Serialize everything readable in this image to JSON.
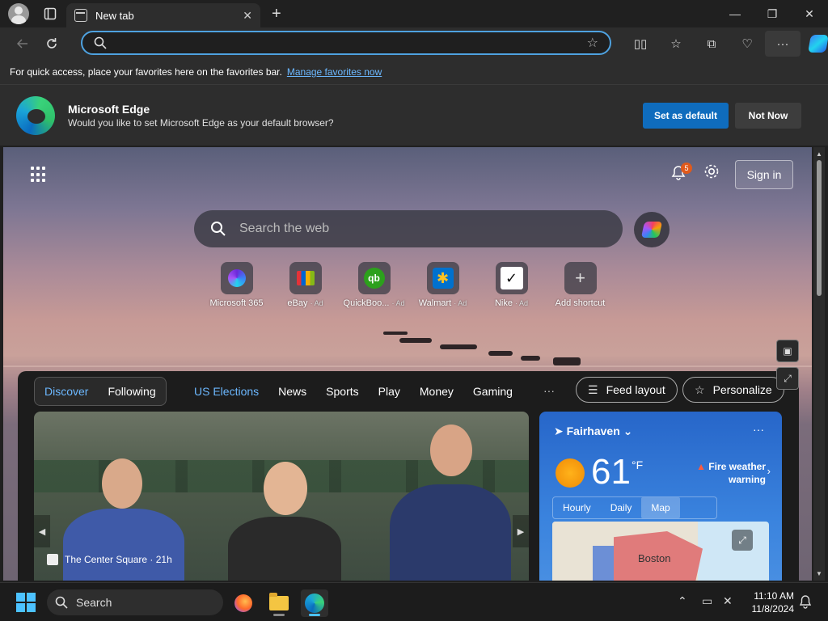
{
  "browser": {
    "tab_title": "New tab",
    "close_tab": "✕",
    "new_tab": "+",
    "minimize": "—",
    "restore": "❐",
    "close": "✕",
    "address_value": "",
    "address_placeholder": ""
  },
  "favorites_bar": {
    "message": "For quick access, place your favorites here on the favorites bar.",
    "link": "Manage favorites now"
  },
  "default_banner": {
    "title": "Microsoft Edge",
    "subtitle": "Would you like to set Microsoft Edge as your default browser?",
    "set_default": "Set as default",
    "not_now": "Not Now"
  },
  "page": {
    "notification_count": "5",
    "sign_in": "Sign in",
    "search_placeholder": "Search the web",
    "quick_links": [
      {
        "label": "Microsoft 365",
        "ad": ""
      },
      {
        "label": "eBay",
        "ad": "· Ad"
      },
      {
        "label": "QuickBoo...",
        "ad": "· Ad"
      },
      {
        "label": "Walmart",
        "ad": "· Ad"
      },
      {
        "label": "Nike",
        "ad": "· Ad"
      },
      {
        "label": "Add shortcut",
        "ad": ""
      }
    ],
    "quick_link_glyphs": {
      "quickbooks": "qb",
      "walmart": "✱",
      "nike": "✓",
      "add": "+"
    }
  },
  "feed": {
    "pill_tabs": [
      "Discover",
      "Following"
    ],
    "nav_tabs": [
      "US Elections",
      "News",
      "Sports",
      "Play",
      "Money",
      "Gaming"
    ],
    "more": "···",
    "feed_layout": "Feed layout",
    "personalize": "Personalize",
    "news_source": "The Center Square · 21h"
  },
  "weather": {
    "location": "Fairhaven",
    "temperature": "61",
    "unit": "°F",
    "alert": "Fire weather warning",
    "tabs": [
      "Hourly",
      "Daily",
      "Map"
    ],
    "selected_tab": "Map",
    "map_city": "Boston",
    "more": "···"
  },
  "taskbar": {
    "search_label": "Search",
    "time": "11:10 AM",
    "date": "11/8/2024"
  },
  "colors": {
    "accent": "#0f6cbd",
    "link": "#6cb8ff",
    "address_focus": "#4ea2e0",
    "notification_badge": "#e05a1c"
  }
}
